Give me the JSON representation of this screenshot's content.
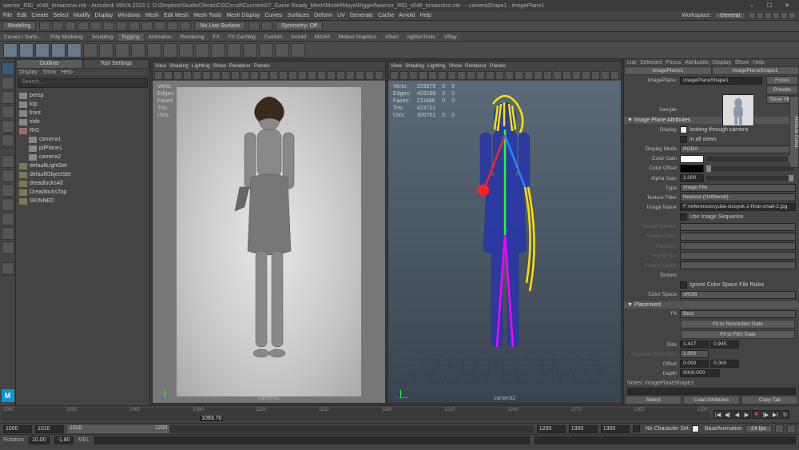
{
  "title": "warrior_RIG_v048_tomasstvo.mb - Autodesk MAYA 2023.1: D:\\Dropbox\\StudioClients\\CGCircuit\\Courses\\07_Game Ready_Mesh\\Model\\Maya\\Rigged\\warrior_RIG_v048_tomasstvo.mb --- cameraShape1 - imagePlane1",
  "window_controls": {
    "min": "–",
    "max": "☐",
    "close": "✕"
  },
  "menubar": [
    "File",
    "Edit",
    "Create",
    "Select",
    "Modify",
    "Display",
    "Windows",
    "Mesh",
    "Edit Mesh",
    "Mesh Tools",
    "Mesh Display",
    "Curves",
    "Surfaces",
    "Deform",
    "UV",
    "Generate",
    "Cache",
    "Arnold",
    "Help"
  ],
  "workspace": {
    "label": "Workspace:",
    "value": "General"
  },
  "shelfbar": {
    "mode": "Modeling",
    "noLiveSurface": "No Live Surface",
    "symmetry": "Symmetry: Off"
  },
  "shelf_tabs": [
    "Curves / Surfa...",
    "Poly Modeling",
    "Sculpting",
    "Rigging",
    "Animation",
    "Rendering",
    "FX",
    "FX Caching",
    "Custom",
    "Arnold",
    "MASH",
    "Motion Graphics",
    "XGen",
    "ngSkinTools",
    "VRay"
  ],
  "outliner": {
    "tabs": [
      "Outliner",
      "Tool Settings"
    ],
    "menu": [
      "Display",
      "Show",
      "Help"
    ],
    "search_placeholder": "Search...",
    "items": [
      {
        "icon": "cam",
        "label": "persp"
      },
      {
        "icon": "cam",
        "label": "top"
      },
      {
        "icon": "cam",
        "label": "front"
      },
      {
        "icon": "cam",
        "label": "side"
      },
      {
        "icon": "ref",
        "label": "RIG"
      },
      {
        "icon": "cam",
        "label": "camera1",
        "ind": true
      },
      {
        "icon": "cam",
        "label": "pilPlane1",
        "ind": true
      },
      {
        "icon": "cam",
        "label": "camera2",
        "ind": true
      },
      {
        "icon": "set",
        "label": "defaultLightSet"
      },
      {
        "icon": "set",
        "label": "defaultObjectSet"
      },
      {
        "icon": "set",
        "label": "dreadlocksAll"
      },
      {
        "icon": "set",
        "label": "DreadlocksTop"
      },
      {
        "icon": "set",
        "label": "SKINNED"
      }
    ]
  },
  "viewport_menu": [
    "View",
    "Shading",
    "Lighting",
    "Show",
    "Renderer",
    "Panels"
  ],
  "hud_labels": {
    "verts": "Verts:",
    "edges": "Edges:",
    "faces": "Faces:",
    "tris": "Tris:",
    "uvs": "UVs:"
  },
  "vp1": {
    "camera": "camera1",
    "stats": {
      "verts": "",
      "edges": "",
      "faces": "",
      "tris": "",
      "uvs": ""
    }
  },
  "vp2": {
    "camera": "camera2",
    "stats": {
      "verts": "203876",
      "edges": "403189",
      "faces": "211886",
      "tris": "423721",
      "uvs": "300761"
    },
    "stats_sel": {
      "a": "0",
      "b": "0"
    }
  },
  "attr": {
    "menu": [
      "List",
      "Selected",
      "Focus",
      "Attributes",
      "Display",
      "Show",
      "Help"
    ],
    "tabs": [
      "imagePlane1",
      "imagePlaneShape1"
    ],
    "label_imagePlane": "imagePlane:",
    "imagePlane": "imagePlaneShape1",
    "sideBtns": [
      "Focus",
      "Presets",
      "Show  Hide"
    ],
    "sample": "Sample",
    "section_ipa": "▼  Image Plane Attributes",
    "display_label": "Display",
    "display_opts": [
      "looking through camera",
      "in all views"
    ],
    "displayMode_label": "Display Mode",
    "displayMode": "RGBA",
    "colorGain_label": "Color Gain",
    "colorOffset_label": "Color Offset",
    "alphaGain_label": "Alpha Gain",
    "alphaGain": "1.000",
    "type_label": "Type",
    "type": "Image File",
    "textureFilter_label": "Texture Filter",
    "textureFilter": "Nearest (Unfiltered)",
    "imageName_label": "Image Name",
    "imageName": "F:\\references\\yulia-sissyuk-2-final-small-2.jpg",
    "useSeq": "Use Image Sequence",
    "imageNumber_label": "Image Number",
    "frameOffset_label": "Frame Offset",
    "frameIn_label": "Frame In",
    "frameOut_label": "Frame Out",
    "frameCache_label": "Frame Cache",
    "texture_label": "Texture",
    "ignoreCSR": "Ignore Color Space File Rules",
    "colorSpace_label": "Color Space",
    "colorSpace": "sRGB",
    "section_placement": "▼  Placement",
    "fit_label": "Fit",
    "fit": "Best",
    "fitResGate": "Fit to Resolution Gate",
    "fitFilmGate": "Fit to Film Gate",
    "size_label": "Size",
    "size_x": "1.417",
    "size_y": "0.945",
    "squeeze_label": "Squeeze Correction",
    "squeeze": "1.000",
    "offset_label": "Offset",
    "offset_x": "0.000",
    "offset_y": "0.000",
    "depth_label": "Depth",
    "depth": "9000.000",
    "notes_label": "Notes: imagePlaneShape1",
    "bottomBtns": [
      "Select",
      "Load Attributes",
      "Copy Tab"
    ]
  },
  "righttab": "Attribute Editor",
  "timeline": {
    "ticks": [
      "1000",
      "1030",
      "1060",
      "1090",
      "1120",
      "1150",
      "1180",
      "1210",
      "1240",
      "1270",
      "1300",
      "1330"
    ],
    "current": "1093.70"
  },
  "range": {
    "start": "1000",
    "inner_start": "1010",
    "inner_end": "1010",
    "end": "1300",
    "outerEnd": "1300"
  },
  "rangebar_right": {
    "noCharSet": "No Character Set",
    "anim": "BaseAnimation",
    "fps": "24 fps"
  },
  "status": {
    "rotation_label": "Rotation",
    "rot1": "10.00",
    "rot2": "-1.80",
    "mel": "MEL"
  }
}
